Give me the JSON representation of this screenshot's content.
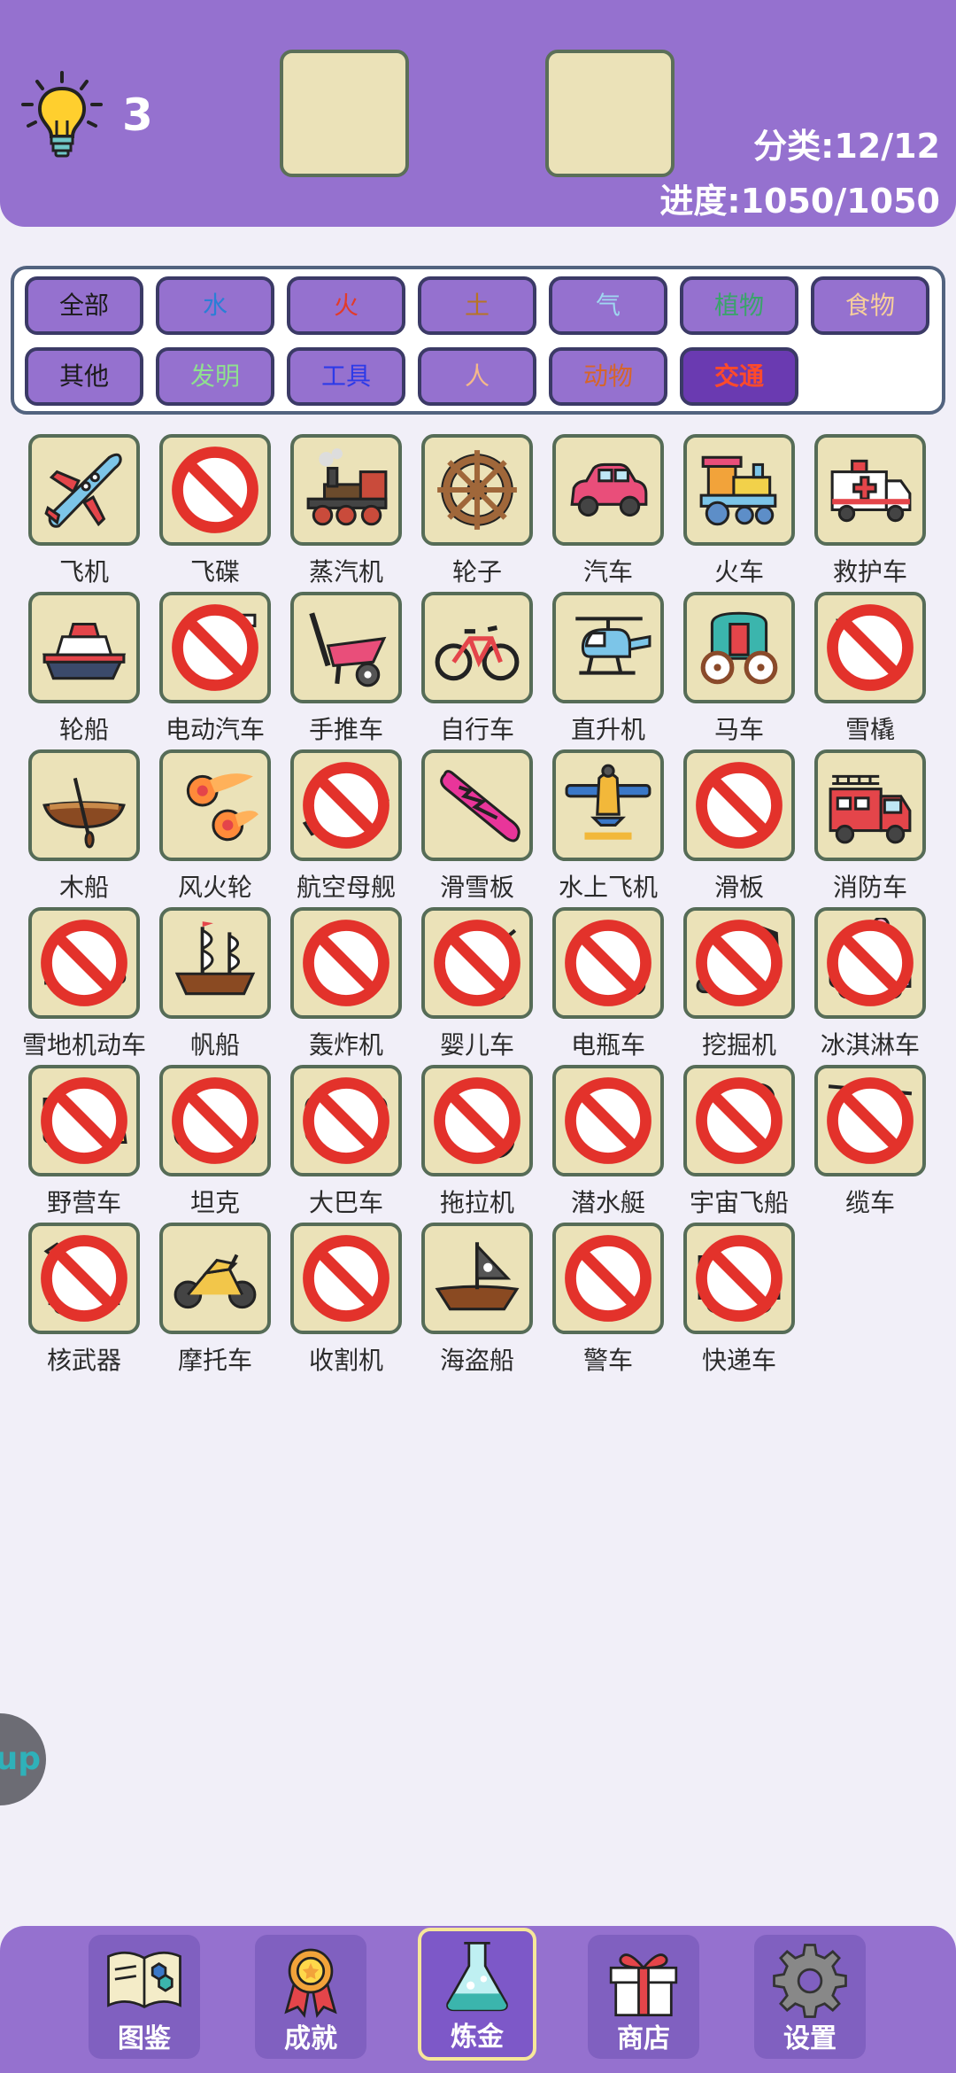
{
  "header": {
    "hint_count": "3",
    "category_count": "分类:12/12",
    "progress": "进度:1050/1050"
  },
  "filters": [
    {
      "label": "全部",
      "color": "#1a1a1a"
    },
    {
      "label": "水",
      "color": "#2a7fd6"
    },
    {
      "label": "火",
      "color": "#e23b2a"
    },
    {
      "label": "土",
      "color": "#b87424"
    },
    {
      "label": "气",
      "color": "#9fd6f0"
    },
    {
      "label": "植物",
      "color": "#3aa36b"
    },
    {
      "label": "食物",
      "color": "#f6ce9c"
    },
    {
      "label": "其他",
      "color": "#1a1a1a"
    },
    {
      "label": "发明",
      "color": "#8fe08f"
    },
    {
      "label": "工具",
      "color": "#2d3ae8"
    },
    {
      "label": "人",
      "color": "#f5b98a"
    },
    {
      "label": "动物",
      "color": "#d6652a"
    },
    {
      "label": "交通",
      "color": "#ff4a2a"
    }
  ],
  "active_filter": "交通",
  "items": [
    {
      "label": "飞机",
      "icon": "airplane-icon",
      "banned": false
    },
    {
      "label": "飞碟",
      "icon": "ufo-icon",
      "banned": true
    },
    {
      "label": "蒸汽机",
      "icon": "steam-engine-icon",
      "banned": false
    },
    {
      "label": "轮子",
      "icon": "wheel-icon",
      "banned": false
    },
    {
      "label": "汽车",
      "icon": "car-icon",
      "banned": false
    },
    {
      "label": "火车",
      "icon": "train-icon",
      "banned": false
    },
    {
      "label": "救护车",
      "icon": "ambulance-icon",
      "banned": false
    },
    {
      "label": "轮船",
      "icon": "ship-icon",
      "banned": false
    },
    {
      "label": "电动汽车",
      "icon": "electric-car-icon",
      "banned": true
    },
    {
      "label": "手推车",
      "icon": "wheelbarrow-icon",
      "banned": false
    },
    {
      "label": "自行车",
      "icon": "bicycle-icon",
      "banned": false
    },
    {
      "label": "直升机",
      "icon": "helicopter-icon",
      "banned": false
    },
    {
      "label": "马车",
      "icon": "carriage-icon",
      "banned": false
    },
    {
      "label": "雪橇",
      "icon": "sled-icon",
      "banned": true
    },
    {
      "label": "木船",
      "icon": "rowboat-icon",
      "banned": false
    },
    {
      "label": "风火轮",
      "icon": "fire-wheels-icon",
      "banned": false
    },
    {
      "label": "航空母舰",
      "icon": "aircraft-carrier-icon",
      "banned": true
    },
    {
      "label": "滑雪板",
      "icon": "snowboard-icon",
      "banned": false
    },
    {
      "label": "水上飞机",
      "icon": "seaplane-icon",
      "banned": false
    },
    {
      "label": "滑板",
      "icon": "skateboard-icon",
      "banned": true
    },
    {
      "label": "消防车",
      "icon": "fire-truck-icon",
      "banned": false
    },
    {
      "label": "雪地机动车",
      "icon": "snowmobile-icon",
      "banned": true
    },
    {
      "label": "帆船",
      "icon": "sailing-ship-icon",
      "banned": false
    },
    {
      "label": "轰炸机",
      "icon": "bomber-icon",
      "banned": true
    },
    {
      "label": "婴儿车",
      "icon": "stroller-icon",
      "banned": true
    },
    {
      "label": "电瓶车",
      "icon": "scooter-icon",
      "banned": true
    },
    {
      "label": "挖掘机",
      "icon": "excavator-icon",
      "banned": true
    },
    {
      "label": "冰淇淋车",
      "icon": "ice-cream-truck-icon",
      "banned": true
    },
    {
      "label": "野营车",
      "icon": "camper-van-icon",
      "banned": true
    },
    {
      "label": "坦克",
      "icon": "tank-icon",
      "banned": true
    },
    {
      "label": "大巴车",
      "icon": "bus-icon",
      "banned": true
    },
    {
      "label": "拖拉机",
      "icon": "tractor-icon",
      "banned": true
    },
    {
      "label": "潜水艇",
      "icon": "submarine-icon",
      "banned": true
    },
    {
      "label": "宇宙飞船",
      "icon": "rocket-icon",
      "banned": true
    },
    {
      "label": "缆车",
      "icon": "cable-car-icon",
      "banned": true
    },
    {
      "label": "核武器",
      "icon": "nuclear-missile-icon",
      "banned": true
    },
    {
      "label": "摩托车",
      "icon": "motorcycle-icon",
      "banned": false
    },
    {
      "label": "收割机",
      "icon": "harvester-icon",
      "banned": true
    },
    {
      "label": "海盗船",
      "icon": "pirate-ship-icon",
      "banned": false
    },
    {
      "label": "警车",
      "icon": "police-car-icon",
      "banned": true
    },
    {
      "label": "快递车",
      "icon": "delivery-truck-icon",
      "banned": true
    }
  ],
  "side_tab": "up",
  "nav": [
    {
      "label": "图鉴",
      "icon": "encyclopedia-book-icon"
    },
    {
      "label": "成就",
      "icon": "medal-icon"
    },
    {
      "label": "炼金",
      "icon": "flask-icon"
    },
    {
      "label": "商店",
      "icon": "gift-box-icon"
    },
    {
      "label": "设置",
      "icon": "gear-icon"
    }
  ],
  "active_nav": "炼金"
}
